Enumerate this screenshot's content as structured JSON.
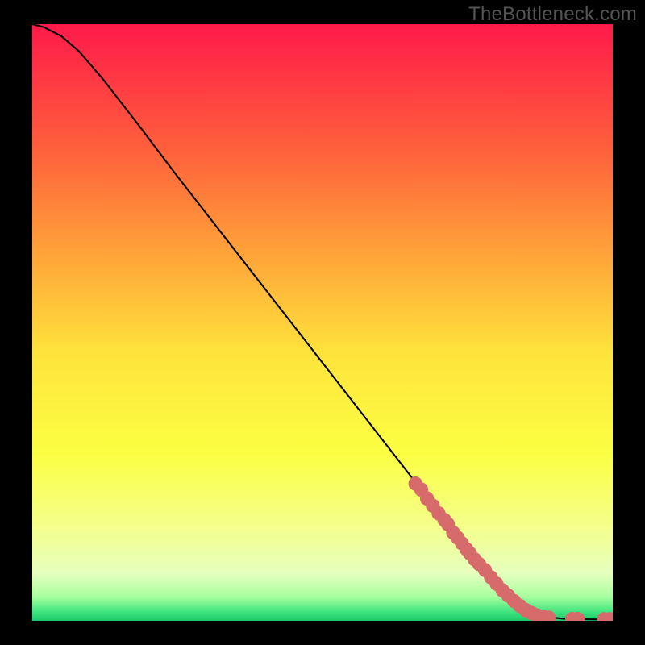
{
  "source_label": "TheBottleneck.com",
  "chart_data": {
    "type": "line",
    "title": "",
    "xlabel": "",
    "ylabel": "",
    "xlim": [
      0,
      100
    ],
    "ylim": [
      0,
      100
    ],
    "background_gradient_stops": [
      {
        "offset": 0.0,
        "color": "#ff1a4a"
      },
      {
        "offset": 0.2,
        "color": "#ff5c3c"
      },
      {
        "offset": 0.4,
        "color": "#ffa939"
      },
      {
        "offset": 0.55,
        "color": "#ffe33c"
      },
      {
        "offset": 0.72,
        "color": "#fbff42"
      },
      {
        "offset": 0.84,
        "color": "#f5ff8a"
      },
      {
        "offset": 0.92,
        "color": "#e6ffbe"
      },
      {
        "offset": 0.96,
        "color": "#a7ff9e"
      },
      {
        "offset": 0.985,
        "color": "#3fe47f"
      },
      {
        "offset": 1.0,
        "color": "#19c96b"
      }
    ],
    "curve": [
      {
        "x": 0,
        "y": 100.0
      },
      {
        "x": 2,
        "y": 99.5
      },
      {
        "x": 5,
        "y": 98.0
      },
      {
        "x": 8,
        "y": 95.5
      },
      {
        "x": 12,
        "y": 91.0
      },
      {
        "x": 18,
        "y": 83.5
      },
      {
        "x": 25,
        "y": 74.5
      },
      {
        "x": 35,
        "y": 62.0
      },
      {
        "x": 45,
        "y": 49.5
      },
      {
        "x": 55,
        "y": 37.0
      },
      {
        "x": 65,
        "y": 24.5
      },
      {
        "x": 73,
        "y": 14.5
      },
      {
        "x": 78,
        "y": 8.5
      },
      {
        "x": 82,
        "y": 4.2
      },
      {
        "x": 85,
        "y": 1.8
      },
      {
        "x": 88,
        "y": 0.7
      },
      {
        "x": 92,
        "y": 0.3
      },
      {
        "x": 100,
        "y": 0.2
      }
    ],
    "markers": {
      "color": "#d76a6a",
      "radius": 1.2,
      "points": [
        {
          "x": 66,
          "y": 23.0
        },
        {
          "x": 67,
          "y": 22.0
        },
        {
          "x": 68,
          "y": 20.5
        },
        {
          "x": 69,
          "y": 19.3
        },
        {
          "x": 70,
          "y": 18.0
        },
        {
          "x": 71,
          "y": 16.9
        },
        {
          "x": 71.6,
          "y": 16.2
        },
        {
          "x": 72.5,
          "y": 14.8
        },
        {
          "x": 73.3,
          "y": 13.9
        },
        {
          "x": 74.0,
          "y": 13.0
        },
        {
          "x": 74.8,
          "y": 12.0
        },
        {
          "x": 75.4,
          "y": 11.3
        },
        {
          "x": 76.2,
          "y": 10.3
        },
        {
          "x": 77.0,
          "y": 9.5
        },
        {
          "x": 78.0,
          "y": 8.5
        },
        {
          "x": 79.0,
          "y": 7.3
        },
        {
          "x": 80.0,
          "y": 6.2
        },
        {
          "x": 81.0,
          "y": 5.1
        },
        {
          "x": 82.0,
          "y": 4.2
        },
        {
          "x": 83.0,
          "y": 3.3
        },
        {
          "x": 84.0,
          "y": 2.5
        },
        {
          "x": 85.0,
          "y": 1.8
        },
        {
          "x": 86.0,
          "y": 1.3
        },
        {
          "x": 87.0,
          "y": 0.9
        },
        {
          "x": 88.0,
          "y": 0.7
        },
        {
          "x": 89.0,
          "y": 0.5
        },
        {
          "x": 93.0,
          "y": 0.3
        },
        {
          "x": 94.0,
          "y": 0.3
        },
        {
          "x": 98.5,
          "y": 0.25
        },
        {
          "x": 99.5,
          "y": 0.25
        }
      ]
    }
  }
}
